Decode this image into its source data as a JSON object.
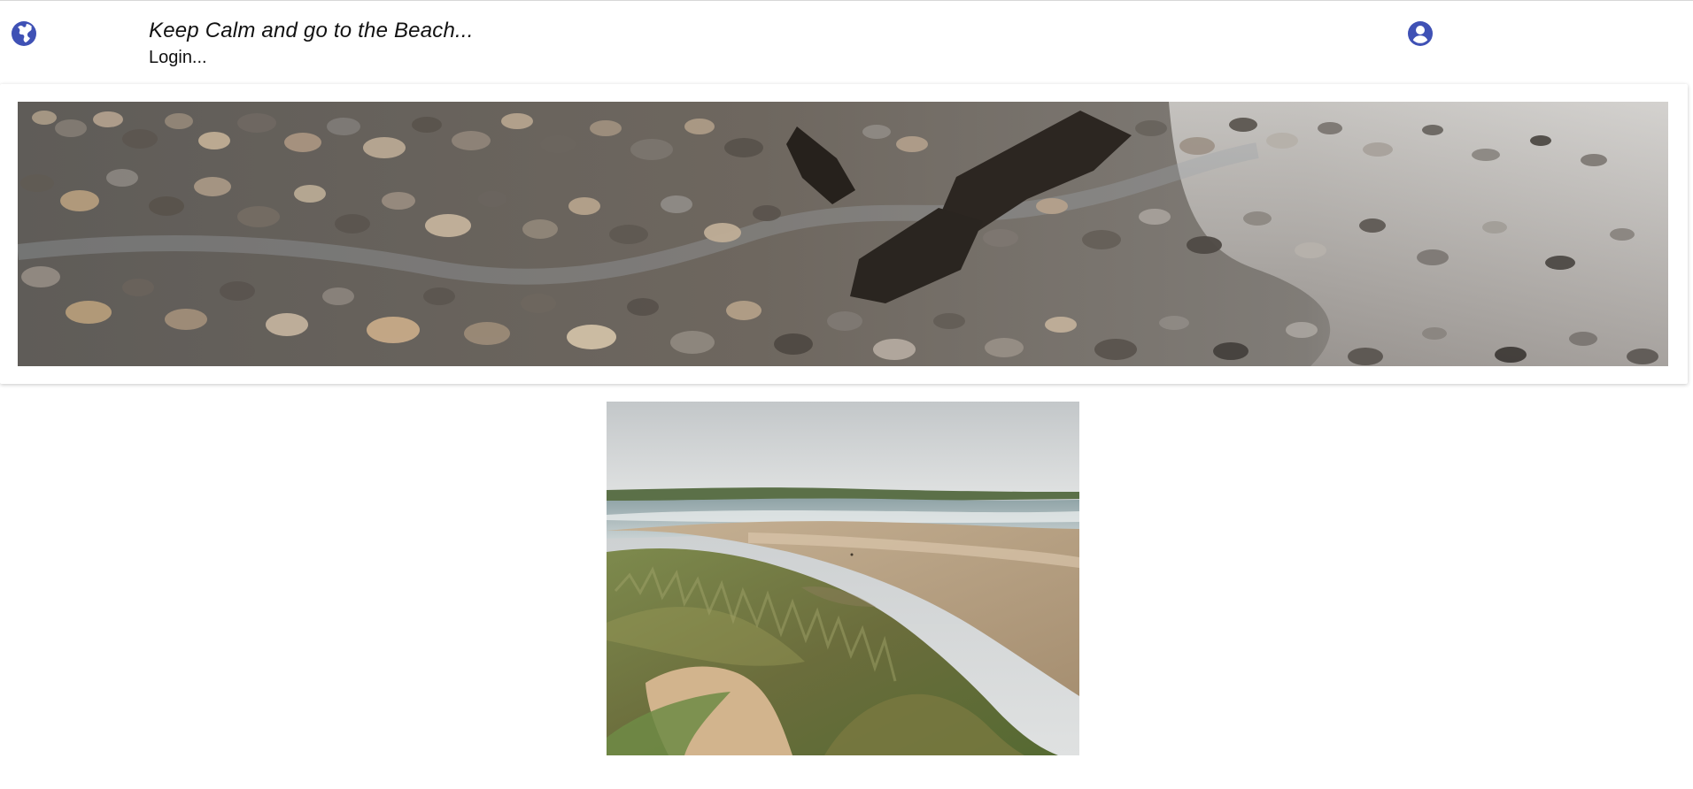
{
  "header": {
    "title": "Keep Calm and go to the Beach...",
    "login_label": "Login..."
  },
  "icons": {
    "globe": "globe-icon",
    "account": "account-circle-icon"
  },
  "colors": {
    "accent": "#3f51b5",
    "text": "#111111",
    "page": "#ffffff"
  }
}
